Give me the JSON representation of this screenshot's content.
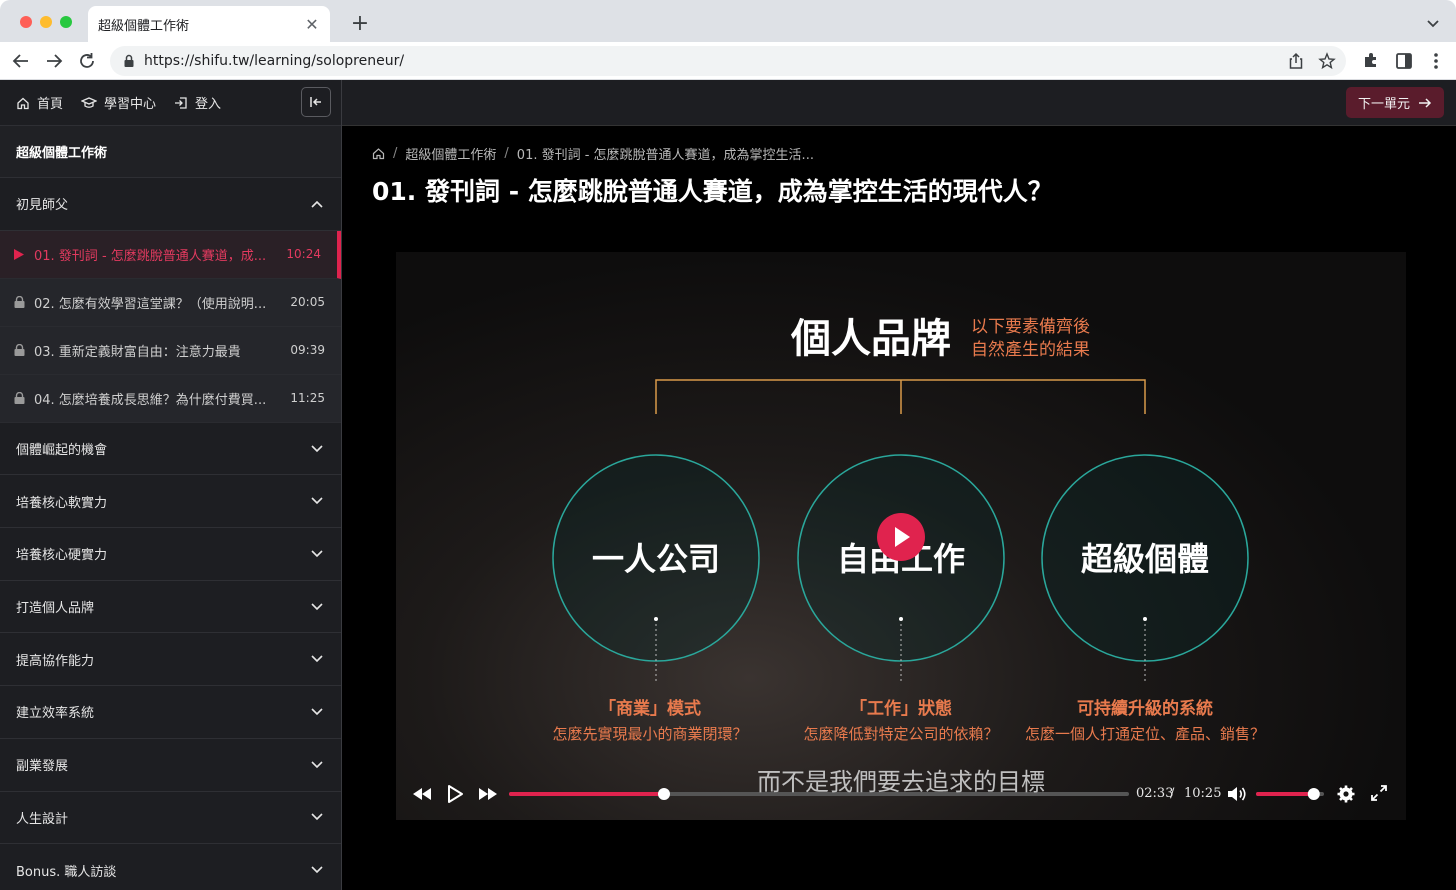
{
  "browser": {
    "tab_title": "超級個體工作術",
    "url": "https://shifu.tw/learning/solopreneur/"
  },
  "sidebar": {
    "nav": [
      {
        "label": "首頁",
        "icon": "home-icon"
      },
      {
        "label": "學習中心",
        "icon": "graduation-cap-icon"
      },
      {
        "label": "登入",
        "icon": "login-icon"
      }
    ],
    "course_title": "超級個體工作術",
    "open_section": "初見師父",
    "lessons": [
      {
        "title": "01. 發刊詞 - 怎麼跳脫普通人賽道，成...",
        "time": "10:24",
        "state": "playing"
      },
      {
        "title": "02. 怎麼有效學習這堂課？（使用說明...",
        "time": "20:05",
        "state": "locked"
      },
      {
        "title": "03. 重新定義財富自由：注意力最貴",
        "time": "09:39",
        "state": "locked"
      },
      {
        "title": "04. 怎麼培養成長思維？為什麼付費買...",
        "time": "11:25",
        "state": "locked"
      }
    ],
    "sections": [
      "個體崛起的機會",
      "培養核心軟實力",
      "培養核心硬實力",
      "打造個人品牌",
      "提高協作能力",
      "建立效率系統",
      "副業發展",
      "人生設計",
      "Bonus. 職人訪談"
    ]
  },
  "main": {
    "next_label": "下一單元",
    "breadcrumb": [
      "超級個體工作術",
      "01. 發刊詞 - 怎麼跳脫普通人賽道，成為掌控生活..."
    ],
    "title": "01. 發刊詞 - 怎麼跳脫普通人賽道，成為掌控生活的現代人？"
  },
  "slide": {
    "heading": "個人品牌",
    "note_line1": "以下要素備齊後",
    "note_line2": "自然產生的結果",
    "circles": [
      "一人公司",
      "自由工作",
      "超級個體"
    ],
    "captions": [
      {
        "line1": "「商業」模式",
        "line2": "怎麼先實現最小的商業閉環？"
      },
      {
        "line1": "「工作」狀態",
        "line2": "怎麼降低對特定公司的依賴？"
      },
      {
        "line1": "可持續升級的系統",
        "line2": "怎麼一個人打通定位、產品、銷售？"
      }
    ]
  },
  "player": {
    "subtitle": "而不是我們要去追求的目標",
    "current_time": "02:33",
    "separator": "/",
    "duration": "10:25",
    "progress": 0.25,
    "volume": 0.85
  },
  "colors": {
    "accent": "#e0234e",
    "slide_orange": "#e87a4d",
    "circle_teal": "#2aa79b"
  }
}
